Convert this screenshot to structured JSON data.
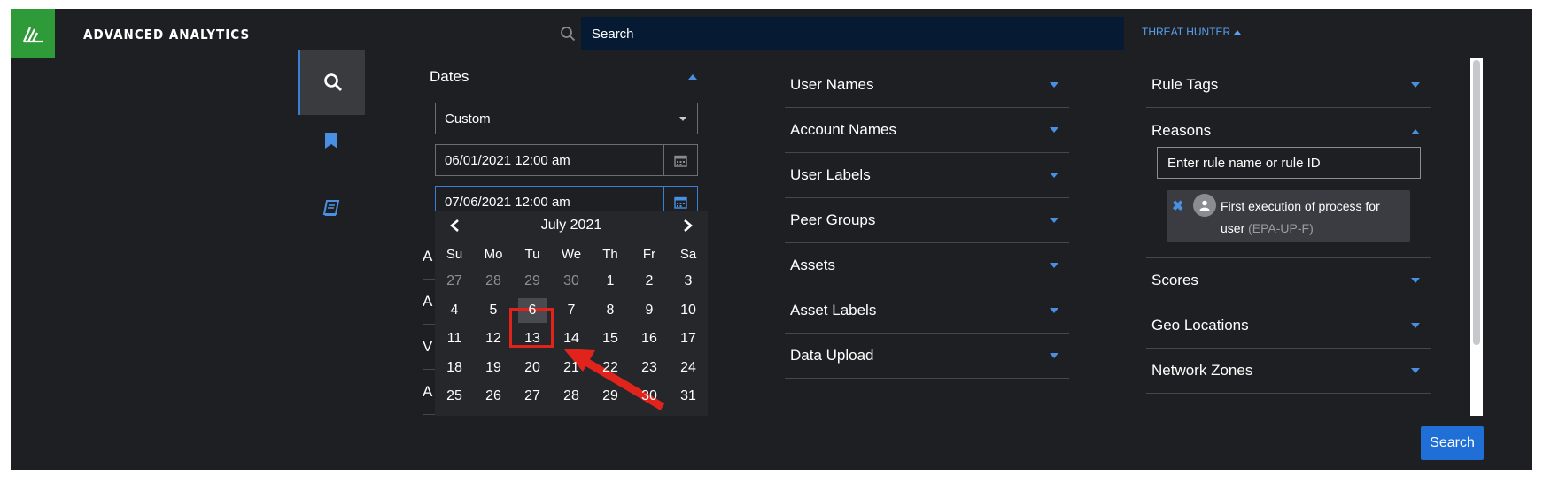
{
  "header": {
    "app_title": "ADVANCED ANALYTICS",
    "search_placeholder": "Search",
    "user_menu_label": "THREAT HUNTER"
  },
  "side_rail": {
    "items": [
      {
        "icon": "search-icon",
        "active": true
      },
      {
        "icon": "bookmark-icon",
        "active": false
      },
      {
        "icon": "book-icon",
        "active": false
      }
    ]
  },
  "dates": {
    "label": "Dates",
    "range_select": "Custom",
    "start": "06/01/2021 12:00 am",
    "end": "07/06/2021 12:00 am",
    "stub_letters": [
      "A",
      "A",
      "V",
      "A"
    ]
  },
  "calendar": {
    "month_label": "July 2021",
    "weekdays": [
      "Su",
      "Mo",
      "Tu",
      "We",
      "Th",
      "Fr",
      "Sa"
    ],
    "selected_day": "6",
    "weeks": [
      [
        "27",
        "28",
        "29",
        "30",
        "1",
        "2",
        "3"
      ],
      [
        "4",
        "5",
        "6",
        "7",
        "8",
        "9",
        "10"
      ],
      [
        "11",
        "12",
        "13",
        "14",
        "15",
        "16",
        "17"
      ],
      [
        "18",
        "19",
        "20",
        "21",
        "22",
        "23",
        "24"
      ],
      [
        "25",
        "26",
        "27",
        "28",
        "29",
        "30",
        "31"
      ]
    ],
    "muted_first_row_count": 4
  },
  "middle_column": {
    "sections": [
      "User Names",
      "Account Names",
      "User Labels",
      "Peer Groups",
      "Assets",
      "Asset Labels",
      "Data Upload"
    ]
  },
  "right_column": {
    "rule_tags": "Rule Tags",
    "reasons": "Reasons",
    "reasons_placeholder": "Enter rule name or rule ID",
    "tag_text": "First execution of process for user",
    "tag_code": "(EPA-UP-F)",
    "sections_after": [
      "Scores",
      "Geo Locations",
      "Network Zones"
    ]
  },
  "footer": {
    "search_button": "Search"
  },
  "colors": {
    "background": "#1e1f22",
    "accent": "#4a90e2",
    "brand_green": "#2f9a38",
    "search_bar": "#071a33",
    "button_blue": "#1f6fd6",
    "annotation_red": "#e0241b"
  }
}
